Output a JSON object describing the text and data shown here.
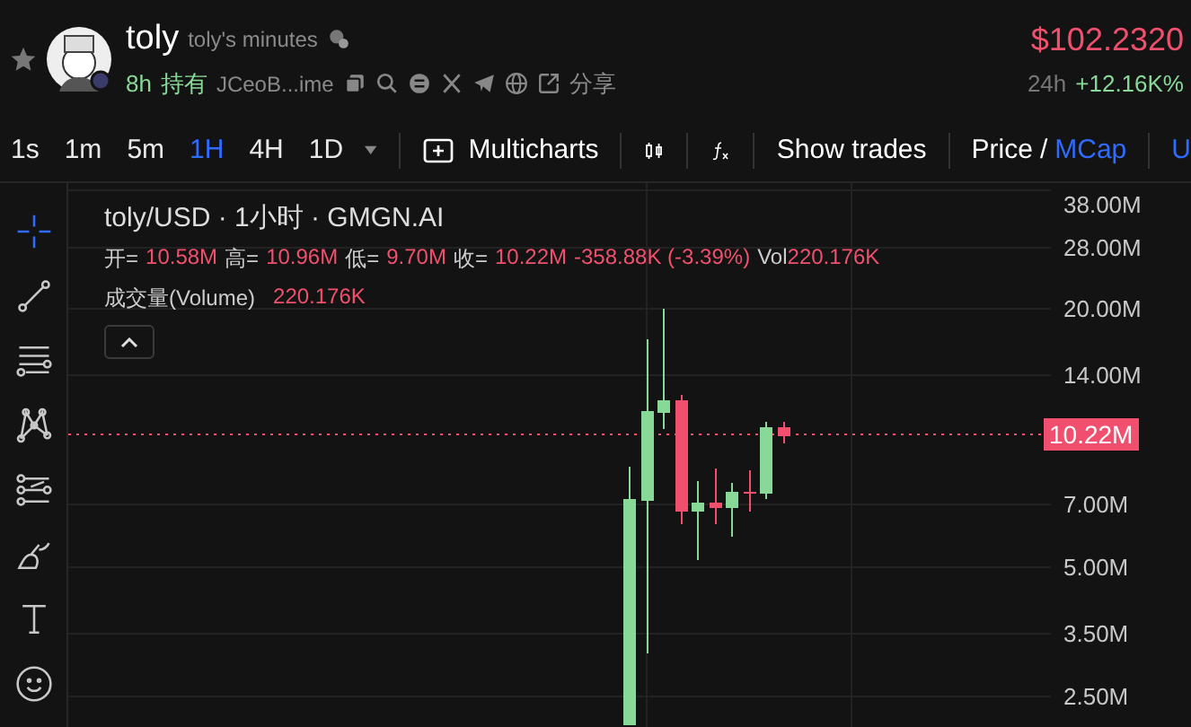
{
  "header": {
    "name": "toly",
    "subtitle": "toly's minutes",
    "holding_time": "8h",
    "holding_label": "持有",
    "address": "JCeoB...ime",
    "share_label": "分享",
    "price": "$102.2320",
    "change_period": "24h",
    "change": "+12.16K%"
  },
  "timeframes": [
    {
      "label": "1s",
      "selected": false
    },
    {
      "label": "1m",
      "selected": false
    },
    {
      "label": "5m",
      "selected": false
    },
    {
      "label": "1H",
      "selected": true
    },
    {
      "label": "4H",
      "selected": false
    },
    {
      "label": "1D",
      "selected": false
    }
  ],
  "toolbar": {
    "multicharts": "Multicharts",
    "show_trades": "Show trades",
    "price_toggle": [
      {
        "label": "Price",
        "selected": false
      },
      {
        "label": "MCap",
        "selected": true
      }
    ],
    "toggle_separator": "/",
    "cut_item": "U"
  },
  "tools": [
    {
      "kind": "crosshair",
      "selected": true
    },
    {
      "kind": "trend-line",
      "selected": false
    },
    {
      "kind": "fib",
      "selected": false
    },
    {
      "kind": "pattern",
      "selected": false
    },
    {
      "kind": "channel",
      "selected": false
    },
    {
      "kind": "brush",
      "selected": false
    },
    {
      "kind": "text",
      "selected": false
    },
    {
      "kind": "emoji",
      "selected": false
    }
  ],
  "legend": {
    "title": "toly/USD · 1小时 · GMGN.AI",
    "ohlc": [
      {
        "label": "开=",
        "value": "10.58M"
      },
      {
        "label": "高=",
        "value": "10.96M"
      },
      {
        "label": "低=",
        "value": "9.70M"
      },
      {
        "label": "收=",
        "value": "10.22M"
      }
    ],
    "change": "-358.88K (-3.39%)",
    "vol_label": "Vol",
    "vol_value": "220.176K",
    "volume_label": "成交量(Volume)",
    "volume_value": "220.176K"
  },
  "price_axis": [
    "38.00M",
    "28.00M",
    "20.00M",
    "14.00M",
    "7.00M",
    "5.00M",
    "3.50M",
    "2.50M"
  ],
  "current_price": "10.22M"
}
